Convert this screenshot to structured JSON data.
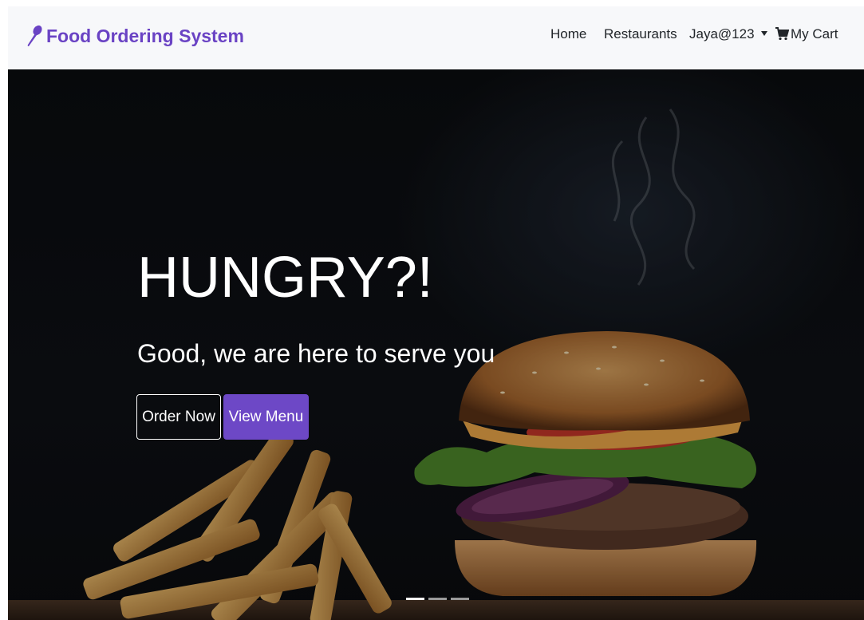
{
  "brand": {
    "name": "Food Ordering System",
    "icon": "spoon-icon",
    "color": "#6a43c4"
  },
  "nav": {
    "home": "Home",
    "restaurants": "Restaurants",
    "user": "Jaya@123",
    "cart": "My Cart",
    "cart_icon": "cart-icon"
  },
  "hero": {
    "headline": "HUNGRY?!",
    "subheadline": "Good, we are here to serve you",
    "order_now": "Order Now",
    "view_menu": "View Menu",
    "accent": "#6d48c6",
    "slides": 3,
    "active_slide": 1
  }
}
